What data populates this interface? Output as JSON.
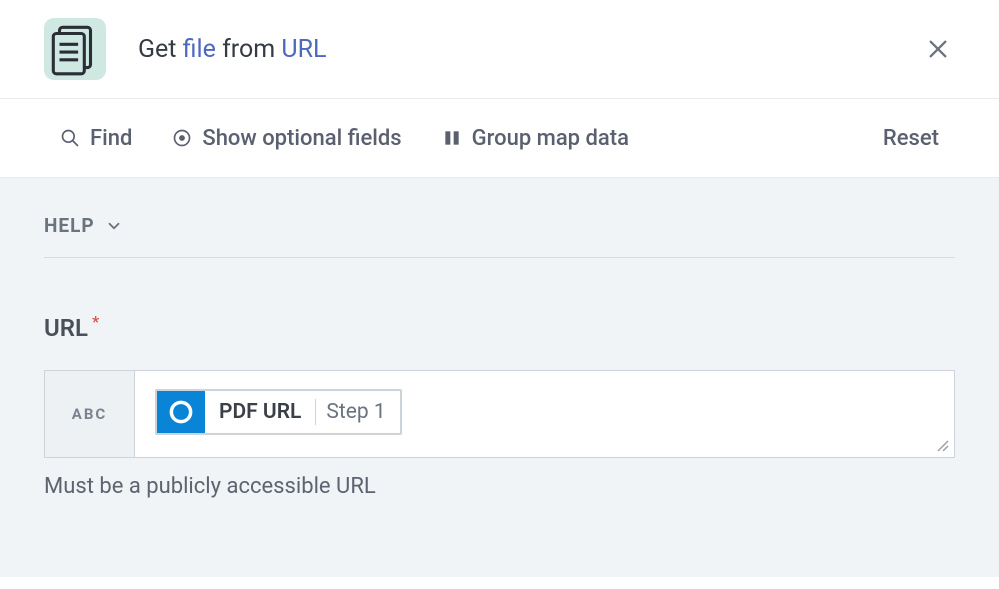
{
  "header": {
    "title_parts": {
      "prefix": "Get ",
      "link1": "file",
      "mid": " from ",
      "link2": "URL"
    }
  },
  "toolbar": {
    "find": "Find",
    "show_optional": "Show optional fields",
    "group_map": "Group map data",
    "reset": "Reset"
  },
  "help": {
    "label": "HELP"
  },
  "field": {
    "label": "URL",
    "required_marker": "*",
    "abc": "ABC",
    "pill_label": "PDF URL",
    "pill_step": "Step 1",
    "help_text": "Must be a publicly accessible URL"
  }
}
